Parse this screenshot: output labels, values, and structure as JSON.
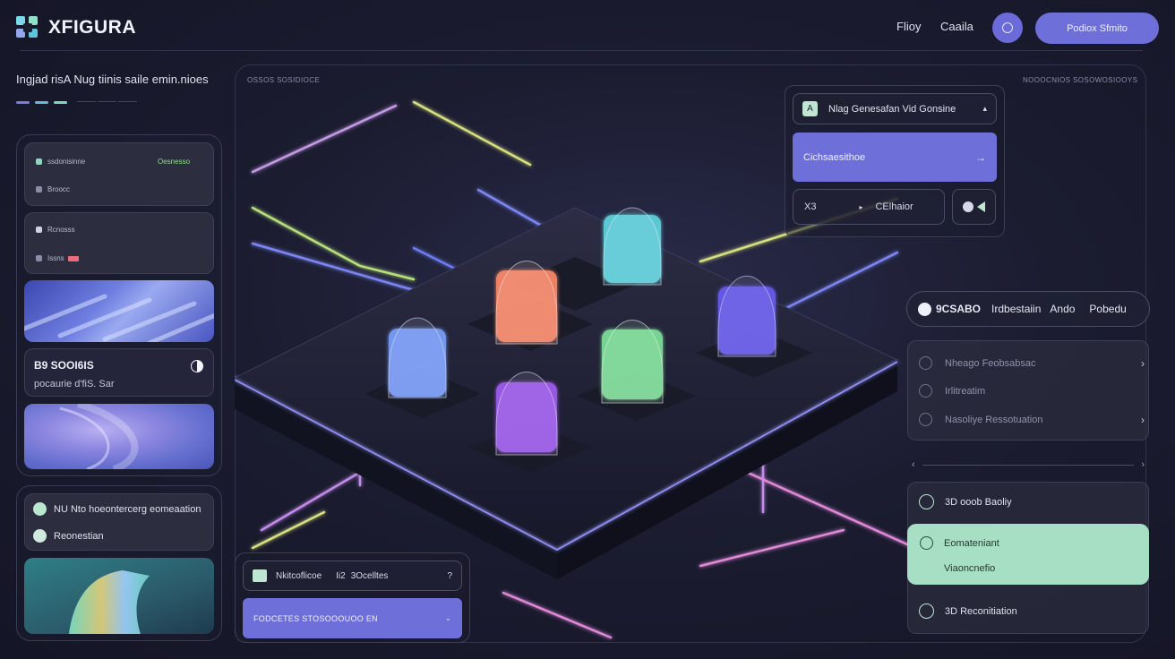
{
  "header": {
    "brand": "XFIGURA",
    "nav": [
      "Flioy",
      "Caaila"
    ],
    "cta": "Podiox Sfmito"
  },
  "left": {
    "tagline": "Ingjad risA Nug tiinis saile emin.nioes",
    "sub": "——— ——— ———",
    "card1": {
      "line1": "ssdonisinne",
      "badge": "Oesnesso",
      "line2": "Broocc"
    },
    "card2": {
      "line1": "Rcnosss",
      "line2": "Issns"
    },
    "stat": {
      "title": "B9 SOOI6IS",
      "caption": "pocaurie d'fiS. Sar"
    },
    "bottom": {
      "item1": "NU Nto hoeontercerg eomeaation",
      "item2": "Reonestian"
    }
  },
  "center": {
    "top_left_label": "OSSOS SOSIDIOCE",
    "top_right_label": "NOOOCNIOS SOSOWOSIOOYS",
    "dropdown": {
      "value": "Nlag Genesafan Vid Gonsine",
      "icon_label": "A"
    },
    "primary": "Cichsaesithoe",
    "arrow": "→",
    "mini_left": "X3",
    "mini_right": "CElhaior",
    "bottom_widget": {
      "left": "Nkitcoflicoe",
      "mid": "Ii2",
      "right": "3Ocelltes",
      "question": "?"
    },
    "bottom_bar": "FODCETES STOSOOOUOO EN"
  },
  "right": {
    "pill": {
      "badge": "9CSABO",
      "word1": "Irdbestaiin",
      "word2": "Ando",
      "word3": "Pobedu"
    },
    "list": [
      "Nheago Feobsabsac",
      "Irlitreatim",
      "Nasoliye Ressotuation"
    ],
    "nav_left": "‹",
    "nav_right": "›",
    "stack": {
      "item1": "3D ooob Baoliy",
      "mint_title": "Eomateniant",
      "mint_sub": "Viaoncnefio",
      "item3": "3D Reconitiation"
    }
  },
  "colors": {
    "accent": "#6f6fd9",
    "mint": "#a7dfc4",
    "cube_cyan": "#5fd6e0",
    "cube_orange": "#ff8a6a",
    "cube_blue": "#7aa0ff",
    "cube_green": "#7fe29a",
    "cube_purple": "#a15cf2",
    "cube_violet": "#6a5cf2"
  }
}
